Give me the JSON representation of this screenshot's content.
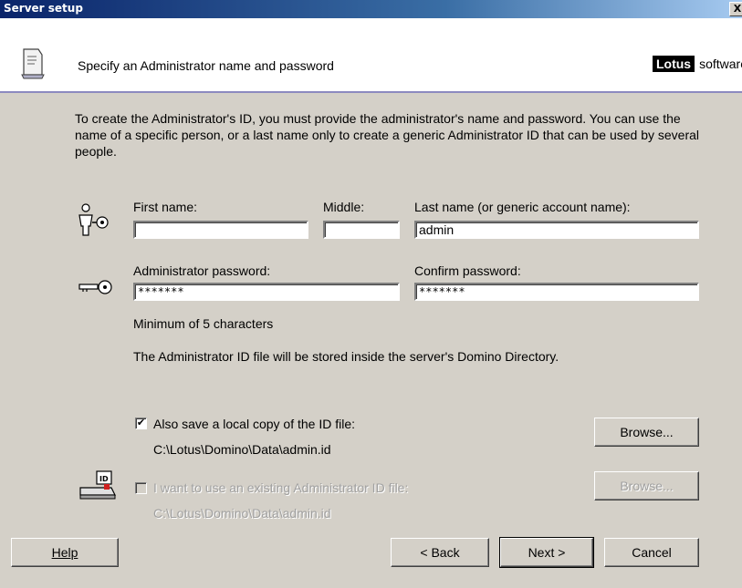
{
  "window": {
    "title": "Server setup",
    "close_label": "X"
  },
  "header": {
    "title": "Specify an Administrator name and password",
    "brand_box": "Lotus",
    "brand_text": "software"
  },
  "intro": "To create the Administrator's ID, you must provide the administrator's name and password. You can use the name of a specific person, or a last name only to create a generic Administrator ID that can be used by several people.",
  "name_fields": {
    "first_label": "First name:",
    "first_value": "",
    "middle_label": "Middle:",
    "middle_value": "",
    "last_label": "Last name (or generic account name):",
    "last_value": "admin"
  },
  "password_fields": {
    "password_label": "Administrator password:",
    "password_value": "*******",
    "confirm_label": "Confirm password:",
    "confirm_value": "*******",
    "min_hint": "Minimum of 5 characters",
    "storage_note": "The Administrator ID file will be stored inside the server's Domino Directory."
  },
  "local_copy": {
    "label": "Also save a local copy of the ID file:",
    "checked": true,
    "path": "C:\\Lotus\\Domino\\Data\\admin.id",
    "browse_label": "Browse..."
  },
  "existing_id": {
    "label": "I want to use an existing Administrator ID file:",
    "checked": false,
    "path": "C:\\Lotus\\Domino\\Data\\admin.id",
    "browse_label": "Browse..."
  },
  "footer": {
    "help_label": "Help",
    "back_label": "< Back",
    "next_label": "Next >",
    "cancel_label": "Cancel"
  },
  "icons": {
    "header": "document-server-icon",
    "person": "person-key-icon",
    "key": "key-icon",
    "id_file": "id-file-icon"
  },
  "colors": {
    "dialog_bg": "#d4d0c8",
    "titlebar": "#0a246a",
    "header_bg": "#ffffff",
    "header_rule": "#8c8ac0"
  }
}
